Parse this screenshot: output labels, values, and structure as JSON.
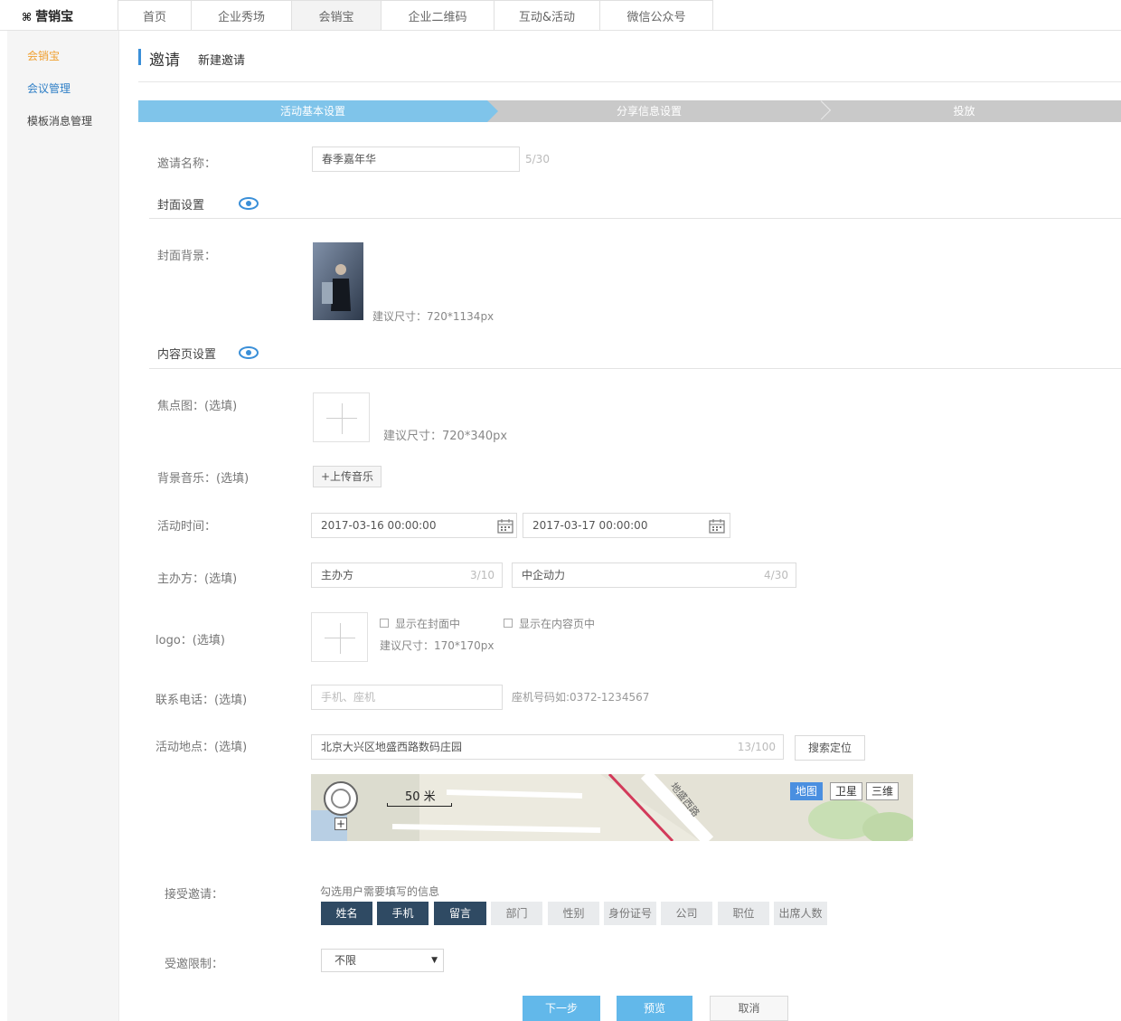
{
  "brand": {
    "icon": "grid-logo-icon",
    "name": "营销宝"
  },
  "topnav": [
    {
      "label": "首页"
    },
    {
      "label": "企业秀场"
    },
    {
      "label": "会销宝"
    },
    {
      "label": "企业二维码"
    },
    {
      "label": "互动&活动"
    },
    {
      "label": "微信公众号"
    }
  ],
  "sidebar": {
    "items": [
      {
        "label": "会销宝"
      },
      {
        "label": "会议管理"
      },
      {
        "label": "模板消息管理"
      }
    ]
  },
  "header": {
    "title": "邀请",
    "subtitle": "新建邀请"
  },
  "steps": [
    {
      "label": "活动基本设置"
    },
    {
      "label": "分享信息设置"
    },
    {
      "label": "投放"
    }
  ],
  "form": {
    "name_label": "邀请名称：",
    "name_value": "春季嘉年华",
    "name_count": "5/30",
    "cover_section": "封面设置",
    "cover_bg_label": "封面背景：",
    "cover_size_hint": "建议尺寸：720*1134px",
    "content_section": "内容页设置",
    "focus_label": "焦点图：(选填)",
    "focus_size_hint": "建议尺寸：720*340px",
    "music_label": "背景音乐：(选填)",
    "music_button": "+上传音乐",
    "time_label": "活动时间：",
    "time_start": "2017-03-16 00:00:00",
    "time_end": "2017-03-17 00:00:00",
    "host_label": "主办方：(选填)",
    "host_placeholder": "主办方",
    "host_count": "3/10",
    "cohost_value": "中企动力",
    "cohost_count": "4/30",
    "logo_label": "logo：(选填)",
    "logo_show_cover": "显示在封面中",
    "logo_show_content": "显示在内容页中",
    "logo_size_hint": "建议尺寸：170*170px",
    "phone_label": "联系电话：(选填)",
    "phone_placeholder": "手机、座机",
    "phone_hint": "座机号码如:0372-1234567",
    "address_label": "活动地点：(选填)",
    "address_value": "北京大兴区地盛西路数码庄园",
    "address_count": "13/100",
    "search_button": "搜索定位"
  },
  "map": {
    "scale": "50 米",
    "types": [
      {
        "label": "地图"
      },
      {
        "label": "卫星"
      },
      {
        "label": "三维"
      }
    ],
    "road": "地盛西路"
  },
  "accept": {
    "label": "接受邀请：",
    "hint": "勾选用户需要填写的信息",
    "fields": [
      {
        "label": "姓名",
        "checked": true
      },
      {
        "label": "手机",
        "checked": true
      },
      {
        "label": "留言",
        "checked": true
      },
      {
        "label": "部门",
        "checked": false
      },
      {
        "label": "性别",
        "checked": false
      },
      {
        "label": "身份证号",
        "checked": false
      },
      {
        "label": "公司",
        "checked": false
      },
      {
        "label": "职位",
        "checked": false
      },
      {
        "label": "出席人数",
        "checked": false
      }
    ]
  },
  "limit": {
    "label": "受邀限制：",
    "value": "不限"
  },
  "actions": {
    "next": "下一步",
    "preview": "预览",
    "cancel": "取消"
  },
  "colors": {
    "accent": "#62b8ea",
    "step_active": "#7fc4ea",
    "tag_on": "#2f4a63",
    "sidebar_active": "#f0a030"
  }
}
